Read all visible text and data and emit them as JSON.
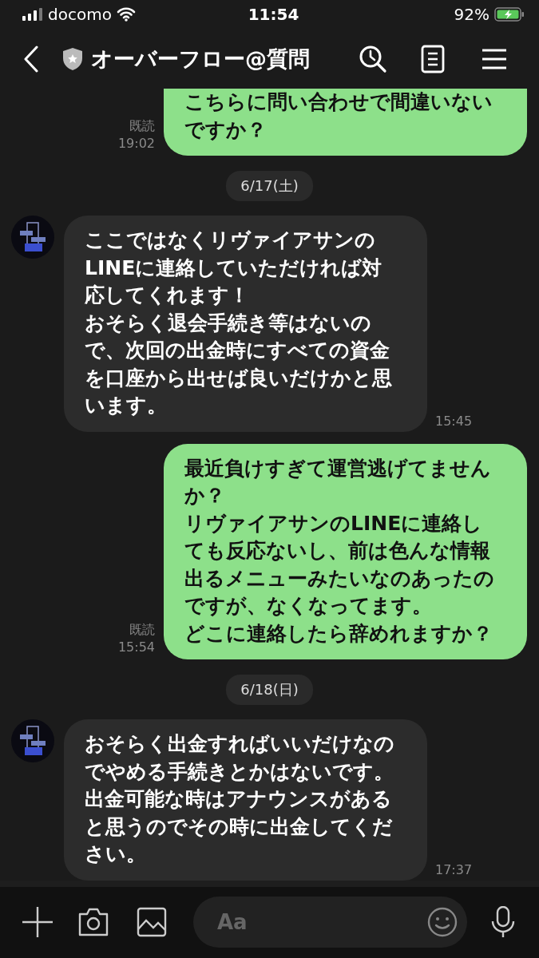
{
  "status_bar": {
    "carrier": "docomo",
    "time": "11:54",
    "battery": "92%"
  },
  "header": {
    "title": "オーバーフロー@質問"
  },
  "messages": [
    {
      "kind": "outgoing",
      "paragraphs": [
        "こちらに問い合わせで間違いないですか？"
      ],
      "read": "既読",
      "time": "19:02"
    },
    {
      "kind": "date",
      "text": "6/17(土)"
    },
    {
      "kind": "incoming",
      "paragraphs": [
        "ここではなくリヴァイアサンのLINEに連絡していただければ対応してくれます！",
        "おそらく退会手続き等はないので、次回の出金時にすべての資金を口座から出せば良いだけかと思います。"
      ],
      "time": "15:45"
    },
    {
      "kind": "outgoing",
      "paragraphs": [
        "最近負けすぎて運営逃げてませんか？",
        "リヴァイアサンのLINEに連絡しても反応ないし、前は色んな情報出るメニューみたいなのあったのですが、なくなってます。",
        "どこに連絡したら辞めれますか？"
      ],
      "read": "既読",
      "time": "15:54"
    },
    {
      "kind": "date",
      "text": "6/18(日)"
    },
    {
      "kind": "incoming",
      "paragraphs": [
        "おそらく出金すればいいだけなのでやめる手続きとかはないです。",
        "出金可能な時はアナウンスがあると思うのでその時に出金してください。"
      ],
      "time": "17:37"
    }
  ],
  "input": {
    "placeholder": "Aa"
  }
}
